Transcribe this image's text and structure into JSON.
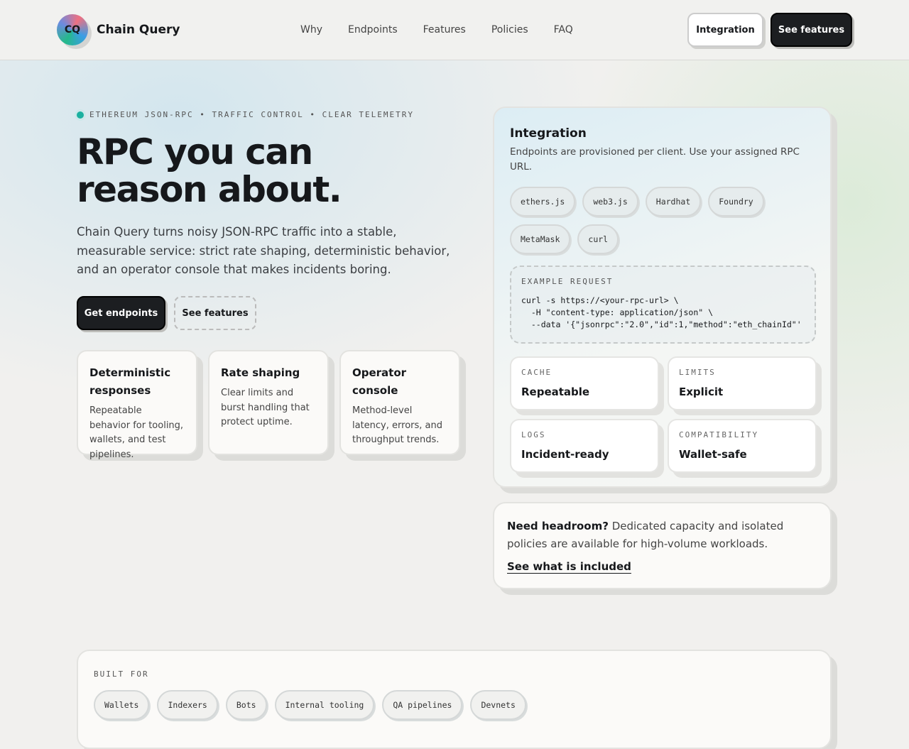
{
  "header": {
    "logo_text": "CQ",
    "brand": "Chain Query",
    "nav": [
      "Why",
      "Endpoints",
      "Features",
      "Policies",
      "FAQ"
    ],
    "integration_btn": "Integration",
    "features_btn": "See features"
  },
  "hero": {
    "eyebrow": "ETHEREUM JSON-RPC • TRAFFIC CONTROL • CLEAR TELEMETRY",
    "title": "RPC you can reason about.",
    "lead": "Chain Query turns noisy JSON-RPC traffic into a stable, measurable service: strict rate shaping, deterministic behavior, and an operator console that makes incidents boring.",
    "cta_primary": "Get endpoints",
    "cta_secondary": "See features"
  },
  "features": [
    {
      "title": "Deterministic responses",
      "desc": "Repeatable behavior for tooling, wallets, and test pipelines."
    },
    {
      "title": "Rate shaping",
      "desc": "Clear limits and burst handling that protect uptime."
    },
    {
      "title": "Operator console",
      "desc": "Method-level latency, errors, and throughput trends."
    }
  ],
  "integration": {
    "title": "Integration",
    "desc": "Endpoints are provisioned per client. Use your assigned RPC URL.",
    "tools": [
      "ethers.js",
      "web3.js",
      "Hardhat",
      "Foundry",
      "MetaMask",
      "curl"
    ],
    "example_label": "EXAMPLE REQUEST",
    "code": [
      "curl -s https://<your-rpc-url> \\",
      "  -H \"content-type: application/json\" \\",
      "  --data '{\"jsonrpc\":\"2.0\",\"id\":1,\"method\":\"eth_chainId\"'"
    ],
    "stats": [
      {
        "k": "CACHE",
        "v": "Repeatable"
      },
      {
        "k": "LIMITS",
        "v": "Explicit"
      },
      {
        "k": "LOGS",
        "v": "Incident-ready"
      },
      {
        "k": "COMPATIBILITY",
        "v": "Wallet-safe"
      }
    ]
  },
  "headroom": {
    "strong": "Need headroom?",
    "text": " Dedicated capacity and isolated policies are available for high-volume workloads.",
    "link": "See what is included"
  },
  "built_for": {
    "label": "BUILT FOR",
    "items": [
      "Wallets",
      "Indexers",
      "Bots",
      "Internal tooling",
      "QA pipelines",
      "Devnets"
    ]
  }
}
